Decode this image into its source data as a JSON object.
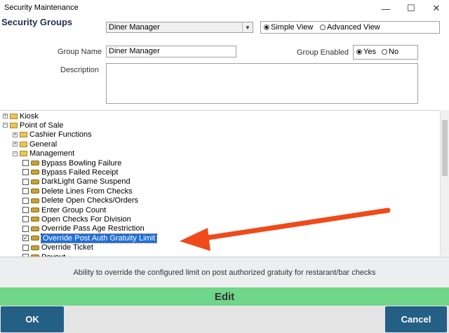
{
  "window": {
    "title": "Security Maintenance",
    "minimize_glyph": "—",
    "maximize_glyph": "☐",
    "close_glyph": "✕"
  },
  "section_title": "Security Groups",
  "group_selector": {
    "value": "Diner Manager",
    "arrow_glyph": "▼"
  },
  "view_toggle": {
    "options": [
      "Simple View",
      "Advanced View"
    ],
    "selected": "Simple View"
  },
  "form": {
    "group_name_label": "Group Name",
    "group_name_value": "Diner Manager",
    "description_label": "Description",
    "description_value": "",
    "group_enabled_label": "Group Enabled",
    "enabled_options": [
      "Yes",
      "No"
    ],
    "enabled_selected": "Yes"
  },
  "tree": {
    "nodes": [
      {
        "label": "Kiosk",
        "level": 0,
        "kind": "folder",
        "expander": "+"
      },
      {
        "label": "Point of Sale",
        "level": 0,
        "kind": "folder-open",
        "expander": "−"
      },
      {
        "label": "Cashier Functions",
        "level": 1,
        "kind": "folder",
        "expander": "+"
      },
      {
        "label": "General",
        "level": 1,
        "kind": "folder",
        "expander": "+"
      },
      {
        "label": "Management",
        "level": 1,
        "kind": "folder-open",
        "expander": "−"
      },
      {
        "label": "Bypass Bowling Failure",
        "level": 2,
        "kind": "key",
        "checked": false
      },
      {
        "label": "Bypass Failed Receipt",
        "level": 2,
        "kind": "key",
        "checked": false
      },
      {
        "label": "DarkLight Game Suspend",
        "level": 2,
        "kind": "key",
        "checked": false
      },
      {
        "label": "Delete Lines From Checks",
        "level": 2,
        "kind": "key",
        "checked": false
      },
      {
        "label": "Delete Open Checks/Orders",
        "level": 2,
        "kind": "key",
        "checked": false
      },
      {
        "label": "Enter Group Count",
        "level": 2,
        "kind": "key",
        "checked": false
      },
      {
        "label": "Open Checks For Division",
        "level": 2,
        "kind": "key",
        "checked": false
      },
      {
        "label": "Override Pass Age Restriction",
        "level": 2,
        "kind": "key",
        "checked": false
      },
      {
        "label": "Override Post Auth Gratuity Limit",
        "level": 2,
        "kind": "key",
        "checked": true,
        "selected": true
      },
      {
        "label": "Override Ticket",
        "level": 2,
        "kind": "key",
        "checked": false
      },
      {
        "label": "Payout",
        "level": 2,
        "kind": "key",
        "checked": false
      }
    ]
  },
  "annotation": {
    "arrow_color": "#f04a1a"
  },
  "description_footer": "Ability to override the configured limit on post authorized gratuity for restarant/bar checks",
  "edit_label": "Edit",
  "buttons": {
    "ok": "OK",
    "cancel": "Cancel"
  },
  "colors": {
    "edit_band": "#6fd68a",
    "button": "#245f86",
    "selection": "#1f6fd8"
  }
}
